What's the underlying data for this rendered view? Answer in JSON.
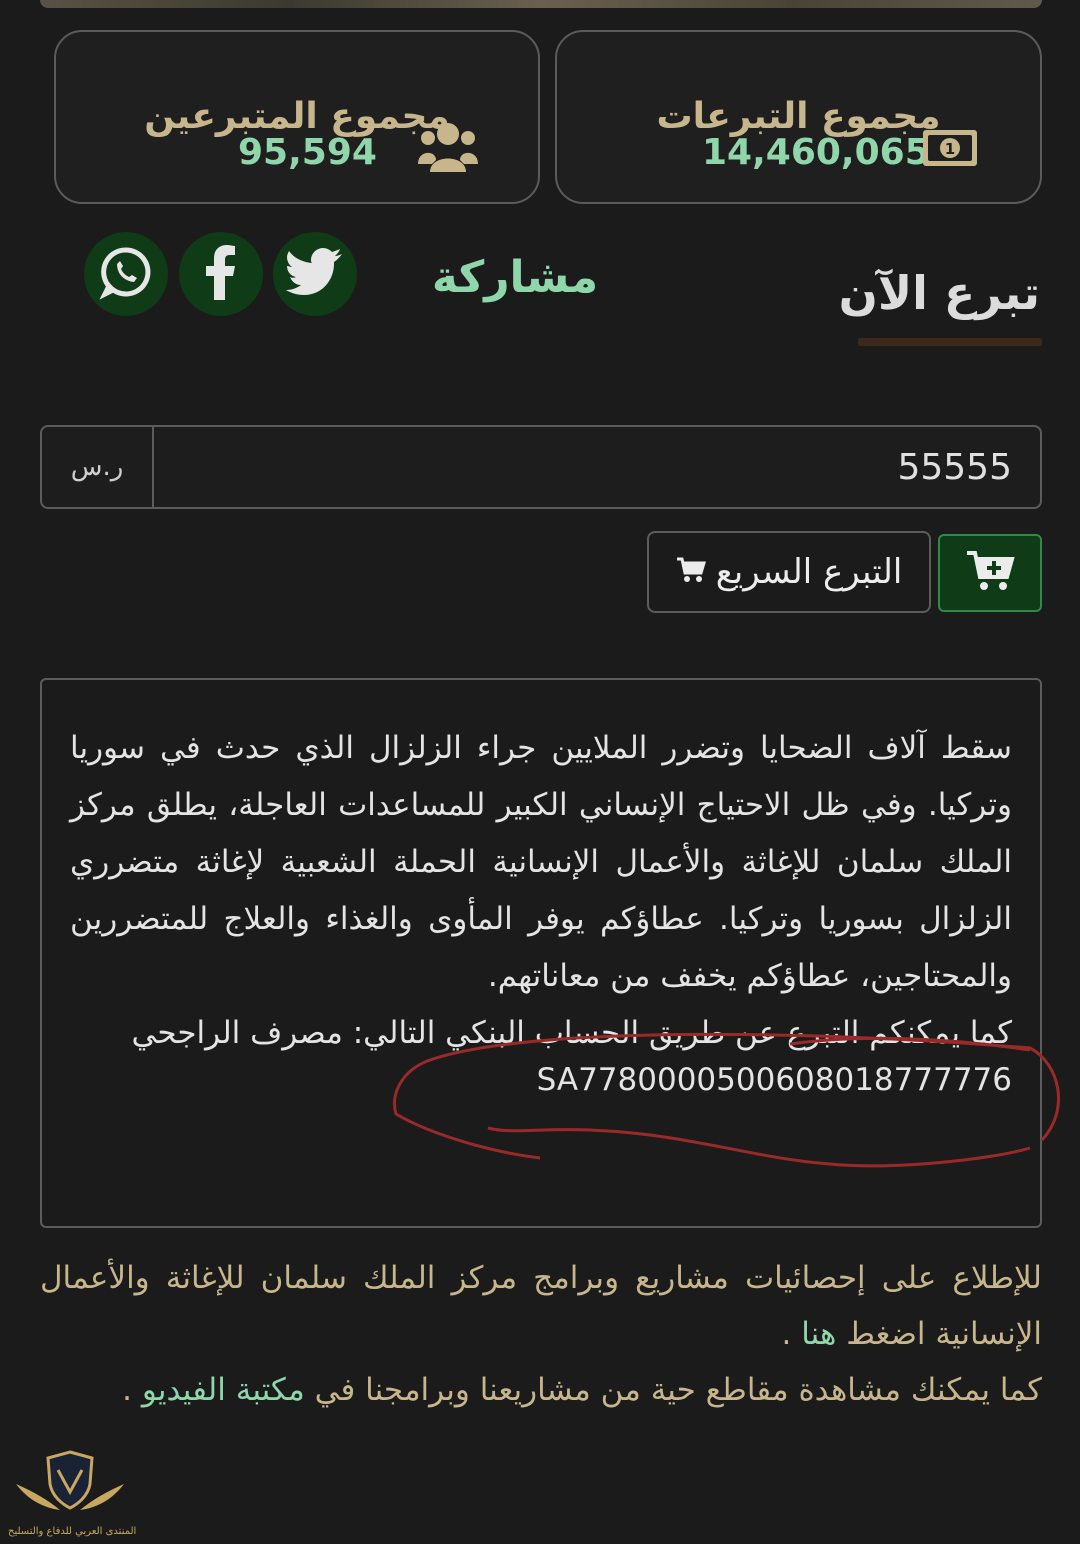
{
  "stats": {
    "donations": {
      "label": "مجموع التبرعات",
      "value": "14,460,065"
    },
    "donors": {
      "label": "مجموع المتبرعين",
      "value": "95,594"
    }
  },
  "share": {
    "label": "مشاركة",
    "networks": [
      "twitter",
      "facebook",
      "whatsapp"
    ]
  },
  "donate": {
    "title": "تبرع الآن",
    "amount": "55555",
    "currency": "ر.س",
    "quick_label": "التبرع السريع"
  },
  "description": {
    "text": "سقط آلاف الضحايا وتضرر الملايين جراء الزلزال الذي حدث في سوريا وتركيا. وفي ظل الاحتياج الإنساني الكبير للمساعدات العاجلة، يطلق مركز الملك سلمان للإغاثة والأعمال الإنسانية الحملة الشعبية لإغاثة متضرري الزلزال بسوريا وتركيا. عطاؤكم يوفر المأوى والغذاء والعلاج للمتضررين والمحتاجين، عطاؤكم يخفف من معاناتهم.",
    "bank_line": "كما يمكنكم التبرع عن طريق الحساب البنكي التالي: مصرف الراجحي",
    "iban": "SA7780000500608018777776"
  },
  "footer": {
    "stats_text": "للإطلاع على إحصائيات مشاريع وبرامج مركز الملك سلمان للإغاثة والأعمال الإنسانية اضغط",
    "stats_link": "هنا",
    "video_text": "كما يمكنك مشاهدة مقاطع حية من مشاريعنا وبرامجنا في",
    "video_link": "مكتبة الفيديو",
    "period": "."
  },
  "watermark": {
    "text": "المنتدى العربي للدفاع والتسليح"
  },
  "colors": {
    "accent_green": "#8fd6aa",
    "gold": "#c7b58c",
    "dark_green": "#0f3b16"
  }
}
